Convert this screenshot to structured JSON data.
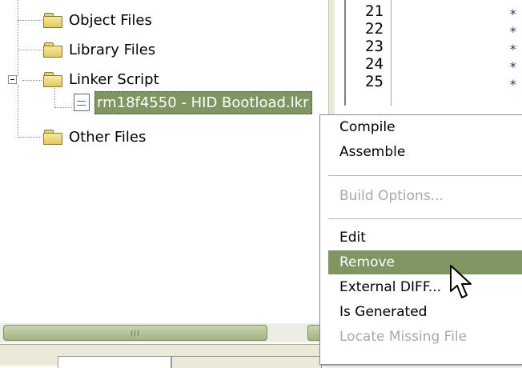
{
  "tree": {
    "items": [
      {
        "label": "Object Files"
      },
      {
        "label": "Library Files"
      },
      {
        "label": "Linker Script"
      },
      {
        "label": "Other Files"
      }
    ],
    "selected_file": "rm18f4550 - HID Bootload.lkr"
  },
  "scrollbar": {
    "grip": "III"
  },
  "editor": {
    "line_numbers": [
      "21",
      "22",
      "23",
      "24",
      "25"
    ],
    "marker": "*"
  },
  "context_menu": {
    "items": [
      {
        "label": "Compile",
        "enabled": true
      },
      {
        "label": "Assemble",
        "enabled": true
      },
      {
        "label": "Build Options...",
        "enabled": false
      },
      {
        "label": "Edit",
        "enabled": true
      },
      {
        "label": "Remove",
        "enabled": true,
        "highlighted": true
      },
      {
        "label": "External DIFF...",
        "enabled": true
      },
      {
        "label": "Is Generated",
        "enabled": true
      },
      {
        "label": "Locate Missing File",
        "enabled": false
      }
    ]
  },
  "colors": {
    "selection": "#7f9662",
    "menu_highlight": "#7f9662",
    "disabled_text": "#a9a9a9"
  },
  "icons": [
    "folder-icon",
    "file-icon",
    "collapse-icon",
    "cursor-icon"
  ]
}
